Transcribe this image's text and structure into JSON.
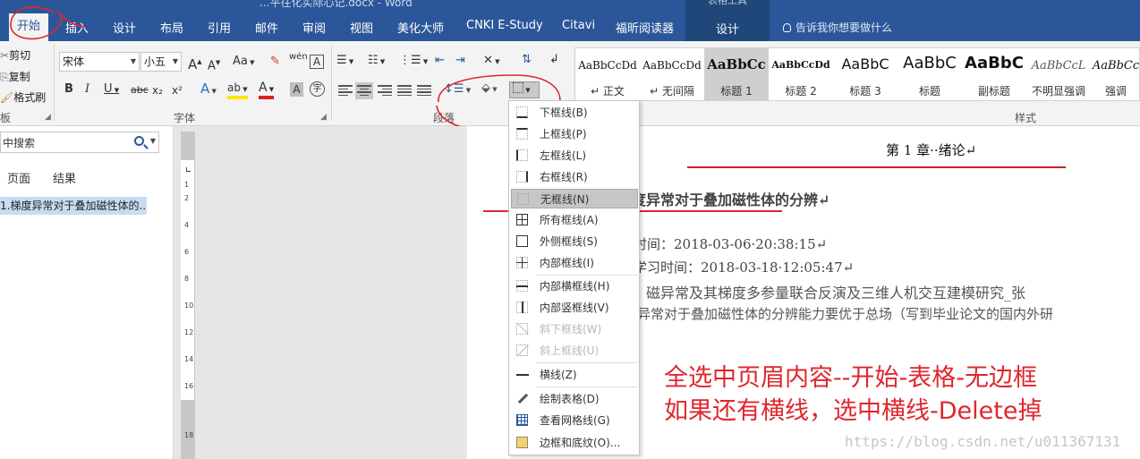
{
  "window": {
    "title": "...平往化实际心记.docx - Word"
  },
  "tabs": [
    {
      "label": "开始",
      "active": true
    },
    {
      "label": "插入"
    },
    {
      "label": "设计"
    },
    {
      "label": "布局"
    },
    {
      "label": "引用"
    },
    {
      "label": "邮件"
    },
    {
      "label": "审阅"
    },
    {
      "label": "视图"
    },
    {
      "label": "美化大师"
    },
    {
      "label": "CNKI E-Study"
    },
    {
      "label": "Citavi"
    },
    {
      "label": "福昕阅读器"
    }
  ],
  "context_tab": {
    "group": "表格工具",
    "label": "设计"
  },
  "tell_me": "告诉我你想要做什么",
  "clipboard": {
    "cut": "剪切",
    "copy": "复制",
    "format_painter": "格式刷",
    "group": "板"
  },
  "font": {
    "name": "宋体",
    "size": "小五",
    "group": "字体",
    "grow": "A",
    "shrink": "A",
    "case": "Aa",
    "phonetic": "wén",
    "bold": "B",
    "italic": "I",
    "underline": "U",
    "strike": "abc",
    "sub": "x₂",
    "sup": "x²",
    "effects": "A",
    "highlight": "ab",
    "color": "A",
    "shade": "A",
    "enclose": "字"
  },
  "paragraph": {
    "group": "段落"
  },
  "styles": {
    "group": "样式",
    "items": [
      {
        "preview": "AaBbCcDd",
        "name": "↵ 正文"
      },
      {
        "preview": "AaBbCcDd",
        "name": "↵ 无间隔"
      },
      {
        "preview": "AaBbCc",
        "name": "标题 1",
        "selected": true
      },
      {
        "preview": "AaBbCcDd",
        "name": "标题 2"
      },
      {
        "preview": "AaBbC",
        "name": "标题 3"
      },
      {
        "preview": "AaBbC",
        "name": "标题"
      },
      {
        "preview": "AaBbC",
        "name": "副标题"
      },
      {
        "preview": "AaBbCcL",
        "name": "不明显强调"
      },
      {
        "preview": "AaBbCc",
        "name": "强调"
      }
    ]
  },
  "nav": {
    "search_placeholder": "中搜索",
    "tabs": [
      "页面",
      "结果"
    ],
    "items": [
      "1.梯度异常对于叠加磁性体的..."
    ]
  },
  "ruler": {
    "numbers": [
      "1",
      "2",
      "4",
      "6",
      "8",
      "10",
      "12",
      "14",
      "16",
      "18"
    ]
  },
  "document": {
    "chapter": "第 1 章··绪论↵",
    "heading": "度异常对于叠加磁性体的分辨↵",
    "meta1": "时间：2018-03-06·20:38:15↵",
    "meta2": "学习时间：2018-03-18·12:05:47↵",
    "body1": "磁异常及其梯度多参量联合反演及三维人机交互建模研究_张",
    "body2": "异常对于叠加磁性体的分辨能力要优于总场（写到毕业论文的国内外研"
  },
  "border_menu": {
    "items": [
      {
        "label": "下框线(B)",
        "icon": "border-bottom-icon",
        "style": "solid-b"
      },
      {
        "label": "上框线(P)",
        "icon": "border-top-icon",
        "style": "solid-t"
      },
      {
        "label": "左框线(L)",
        "icon": "border-left-icon",
        "style": "solid-l"
      },
      {
        "label": "右框线(R)",
        "icon": "border-right-icon",
        "style": "solid-r"
      },
      {
        "label": "无框线(N)",
        "icon": "no-border-icon",
        "style": "",
        "hover": true
      },
      {
        "label": "所有框线(A)",
        "icon": "all-borders-icon",
        "style": "solid-all cross"
      },
      {
        "label": "外侧框线(S)",
        "icon": "outside-borders-icon",
        "style": "solid-out"
      },
      {
        "label": "内部框线(I)",
        "icon": "inside-borders-icon",
        "style": "cross"
      },
      {
        "label": "内部横框线(H)",
        "icon": "inside-horizontal-icon",
        "style": "hline"
      },
      {
        "label": "内部竖框线(V)",
        "icon": "inside-vertical-icon",
        "style": "vline"
      },
      {
        "label": "斜下框线(W)",
        "icon": "diagonal-down-icon",
        "style": "diag-d",
        "disabled": true
      },
      {
        "label": "斜上框线(U)",
        "icon": "diagonal-up-icon",
        "style": "diag-u",
        "disabled": true
      },
      {
        "label": "横线(Z)",
        "icon": "horizontal-line-icon",
        "style": "hrline"
      },
      {
        "label": "绘制表格(D)",
        "icon": "draw-table-icon",
        "style": "pencil"
      },
      {
        "label": "查看网格线(G)",
        "icon": "gridlines-icon",
        "style": "grid"
      },
      {
        "label": "边框和底纹(O)...",
        "icon": "borders-shading-icon",
        "style": "shade"
      }
    ]
  },
  "annotation": {
    "line1": "全选中页眉内容--开始-表格-无边框",
    "line2": "如果还有横线，选中横线-Delete掉",
    "color": "#e0262e"
  },
  "watermark": "https://blog.csdn.net/u011367131",
  "colors": {
    "brand": "#2b579a",
    "ribbon": "#f3f3f3",
    "annotation_red": "#e0262e"
  }
}
